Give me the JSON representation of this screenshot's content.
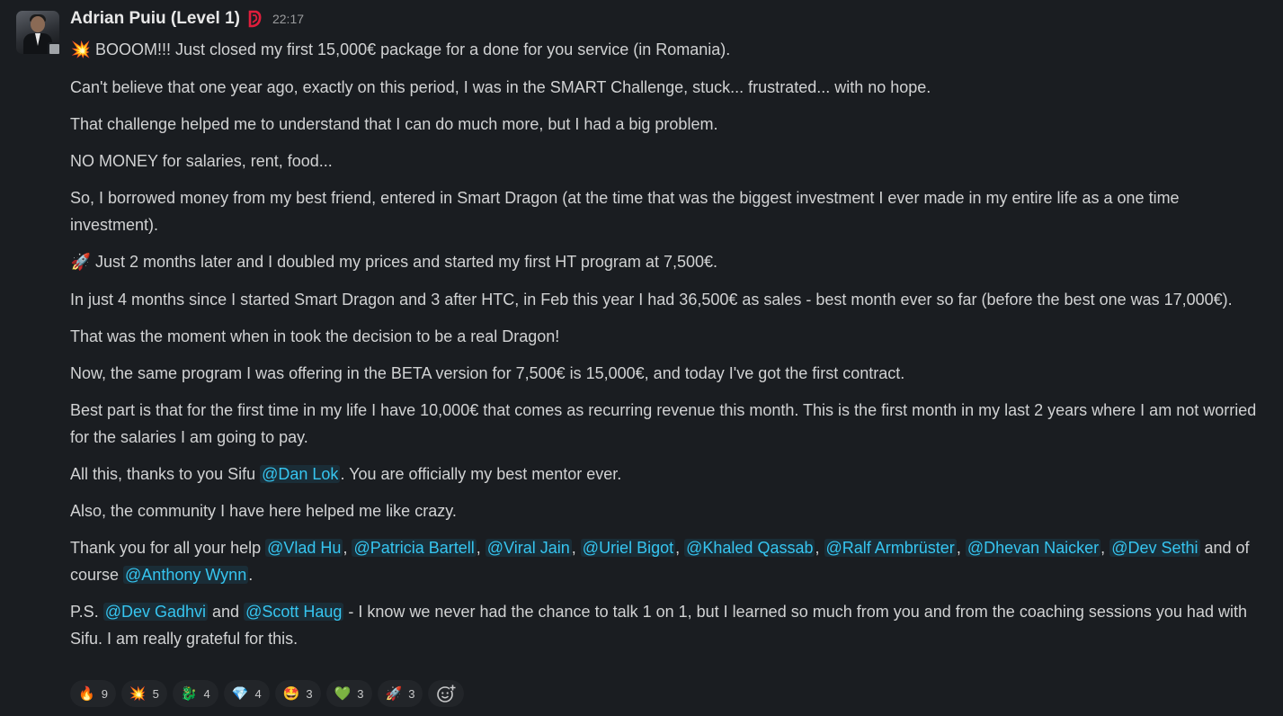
{
  "message": {
    "author": "Adrian Puiu (Level 1)",
    "timestamp": "22:17",
    "badge_icon": "dragon-badge-icon",
    "mention_color": "#36c5f0",
    "paragraphs": {
      "p1": {
        "emoji": "💥",
        "text": "BOOOM!!! Just closed my first 15,000€ package for a done for you service (in Romania)."
      },
      "p2": "Can't believe that one year ago, exactly on this period, I was in the SMART Challenge, stuck... frustrated... with no hope.",
      "p3": "That challenge helped me to understand that I can do much more, but I had a big problem.",
      "p4": "NO MONEY for salaries, rent, food...",
      "p5": "So, I borrowed money from my best friend, entered in Smart Dragon (at the time that was the biggest investment I ever made in my entire life as a one time investment).",
      "p6": {
        "emoji": "🚀",
        "text": "Just 2 months later and I doubled my prices and started my first HT program at 7,500€."
      },
      "p7": "In just 4 months since I started Smart Dragon and 3 after HTC, in Feb this year I had 36,500€ as sales - best month ever so far (before the best one was 17,000€).",
      "p8": "That was the moment when in took the decision to be a real Dragon!",
      "p9": "Now, the same program I was offering in the BETA version for 7,500€ is 15,000€, and today I've got the first contract.",
      "p10": "Best part is that for the first time in my life I have 10,000€ that comes as recurring revenue this month. This is the first month in my last 2 years where I am not worried for the salaries I am going to pay.",
      "p11": {
        "before": "All this, thanks to you Sifu ",
        "mention": "@Dan Lok",
        "after": ". You are officially my best mentor ever."
      },
      "p12": "Also, the community I have here helped me like crazy.",
      "p13": {
        "before": "Thank you for all your help ",
        "mentions": [
          "@Vlad Hu",
          "@Patricia Bartell",
          "@Viral Jain",
          "@Uriel Bigot",
          "@Khaled Qassab",
          "@Ralf Armbrüster",
          "@Dhevan Naicker",
          "@Dev Sethi",
          "@Anthony Wynn"
        ],
        "sep": ", ",
        "and_text": " and of course ",
        "end": "."
      },
      "p14": {
        "before": "P.S. ",
        "mention1": "@Dev Gadhvi",
        "middle": " and ",
        "mention2": "@Scott Haug",
        "after": " - I know we never had the chance to talk 1 on 1, but I learned so much from you and from the coaching sessions you had with Sifu. I am really grateful for this."
      }
    }
  },
  "reactions": [
    {
      "emoji": "🔥",
      "icon": "fire-icon",
      "count": "9"
    },
    {
      "emoji": "💥",
      "icon": "collision-icon",
      "count": "5"
    },
    {
      "emoji": "🐉",
      "icon": "dragon-icon",
      "count": "4"
    },
    {
      "emoji": "💎",
      "icon": "gem-icon",
      "count": "4"
    },
    {
      "emoji": "🤩",
      "icon": "star-struck-icon",
      "count": "3"
    },
    {
      "emoji": "💚",
      "icon": "green-heart-icon",
      "count": "3"
    },
    {
      "emoji": "🚀",
      "icon": "rocket-icon",
      "count": "3"
    }
  ],
  "add_reaction_icon": "add-reaction-icon"
}
